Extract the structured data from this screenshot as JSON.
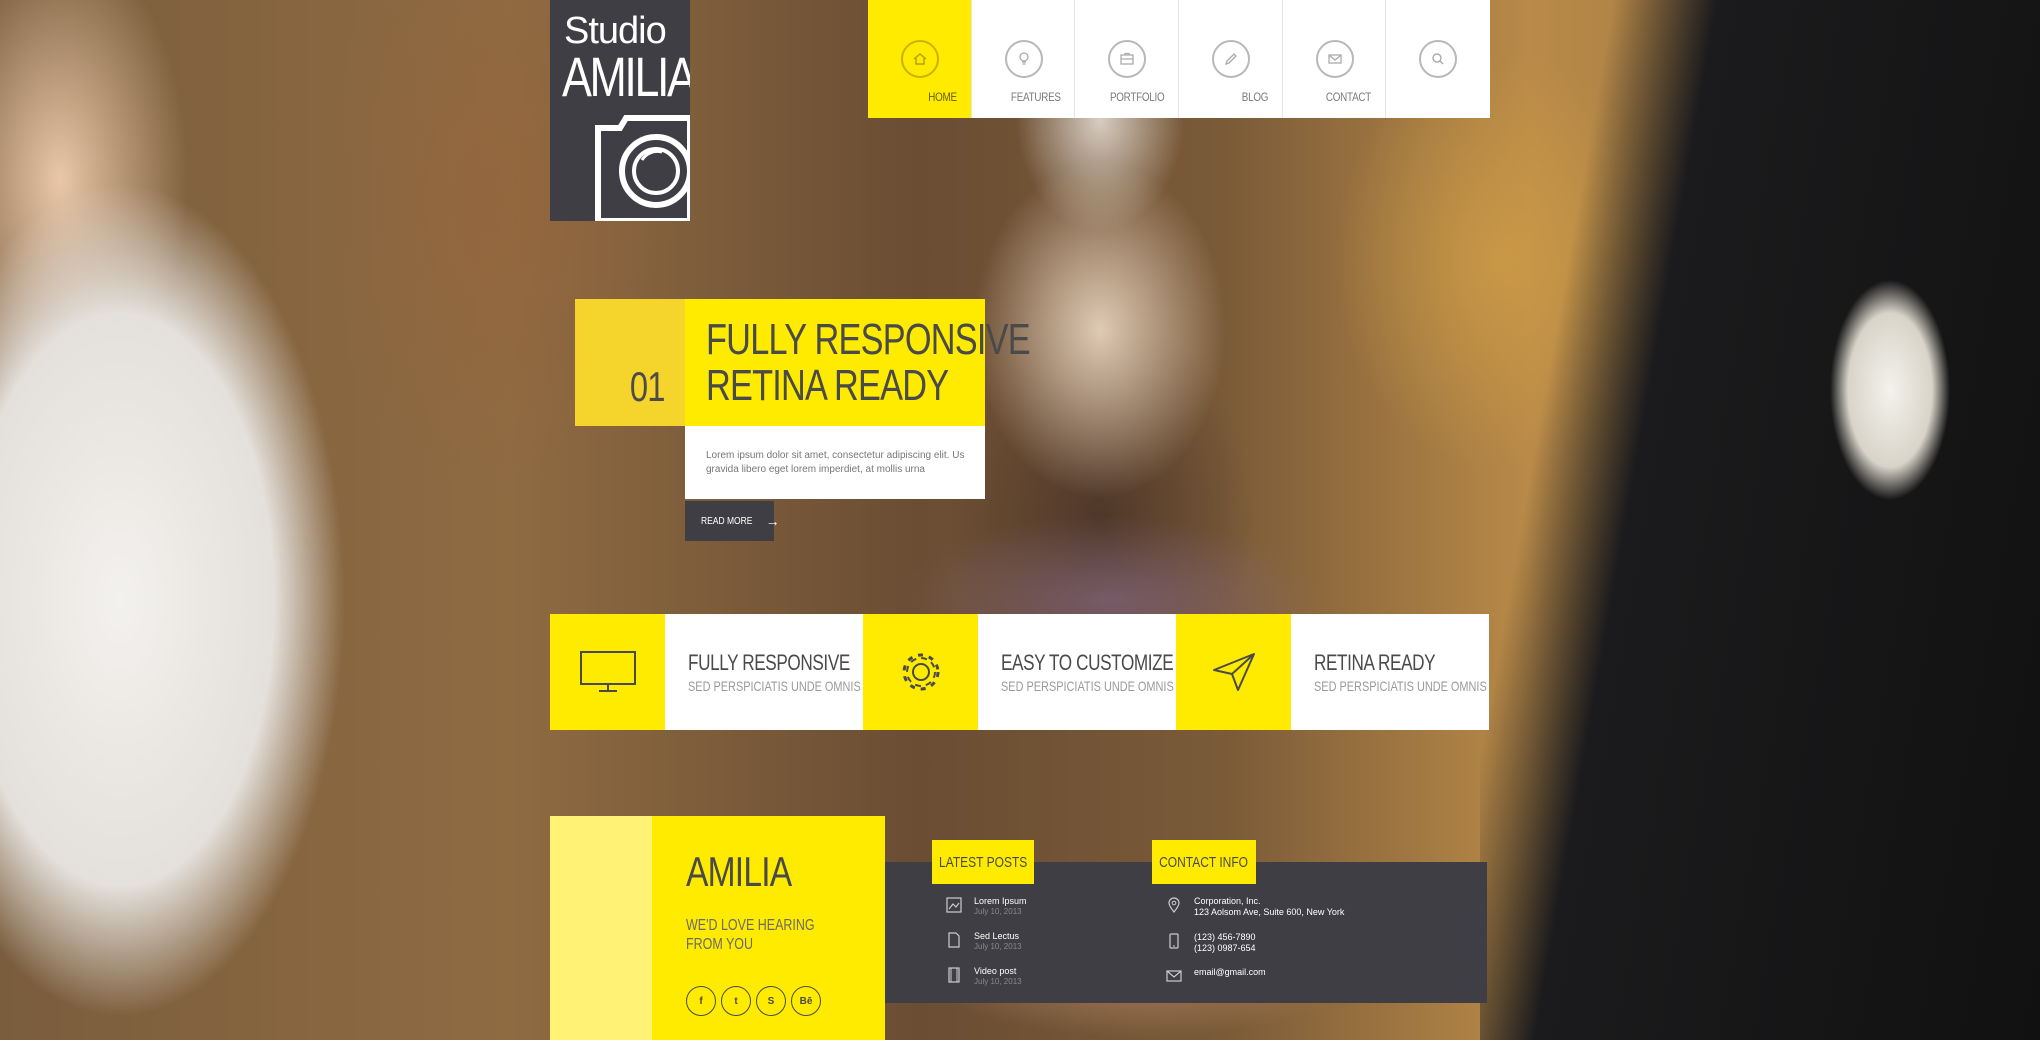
{
  "logo": {
    "line1": "Studio",
    "line2": "AMILIA"
  },
  "nav": {
    "items": [
      {
        "label": "HOME",
        "icon": "home-icon",
        "active": true
      },
      {
        "label": "FEATURES",
        "icon": "lightbulb-icon",
        "active": false
      },
      {
        "label": "PORTFOLIO",
        "icon": "briefcase-icon",
        "active": false
      },
      {
        "label": "BLOG",
        "icon": "pencil-icon",
        "active": false
      },
      {
        "label": "CONTACT",
        "icon": "mail-icon",
        "active": false
      },
      {
        "label": "",
        "icon": "search-icon",
        "active": false
      }
    ]
  },
  "slider": {
    "number": "01",
    "title_line1": "FULLY RESPONSIVE",
    "title_line2": "RETINA READY",
    "text": "Lorem ipsum dolor sit amet, consectetur adipiscing elit. Us gravida libero eget lorem imperdiet, at mollis urna",
    "read_more": "READ MORE"
  },
  "features": [
    {
      "title": "FULLY RESPONSIVE",
      "subtitle": "SED  PERSPICIATIS UNDE OMNIS",
      "icon": "monitor-icon"
    },
    {
      "title": "EASY TO CUSTOMIZE",
      "subtitle": "SED PERSPICIATIS UNDE OMNIS",
      "icon": "gear-icon"
    },
    {
      "title": "RETINA READY",
      "subtitle": "SED PERSPICIATIS UNDE OMNIS",
      "icon": "paper-plane-icon"
    }
  ],
  "footer": {
    "brand": "AMILIA",
    "tagline_line1": "WE'D LOVE HEARING",
    "tagline_line2": "FROM YOU",
    "socials": [
      {
        "label": "f",
        "icon": "facebook-icon"
      },
      {
        "label": "t",
        "icon": "twitter-icon"
      },
      {
        "label": "S",
        "icon": "skype-icon"
      },
      {
        "label": "Bē",
        "icon": "behance-icon"
      }
    ],
    "latest_posts_title": "LATEST POSTS",
    "posts": [
      {
        "title": "Lorem Ipsum",
        "date": "July 10, 2013",
        "icon": "image-icon"
      },
      {
        "title": "Sed Lectus",
        "date": "July 10, 2013",
        "icon": "document-icon"
      },
      {
        "title": "Video post",
        "date": "July 10, 2013",
        "icon": "film-icon"
      }
    ],
    "contact_title": "CONTACT INFO",
    "contact": {
      "company": "Corporation, Inc.",
      "address": "123 Aolsom Ave, Suite 600, New York",
      "phone1": "(123) 456-7890",
      "phone2": "(123) 0987-654",
      "email": "email@gmail.com"
    }
  },
  "colors": {
    "accent": "#ffeb00",
    "accent_light": "#fff274",
    "dark": "#3f3e44"
  }
}
